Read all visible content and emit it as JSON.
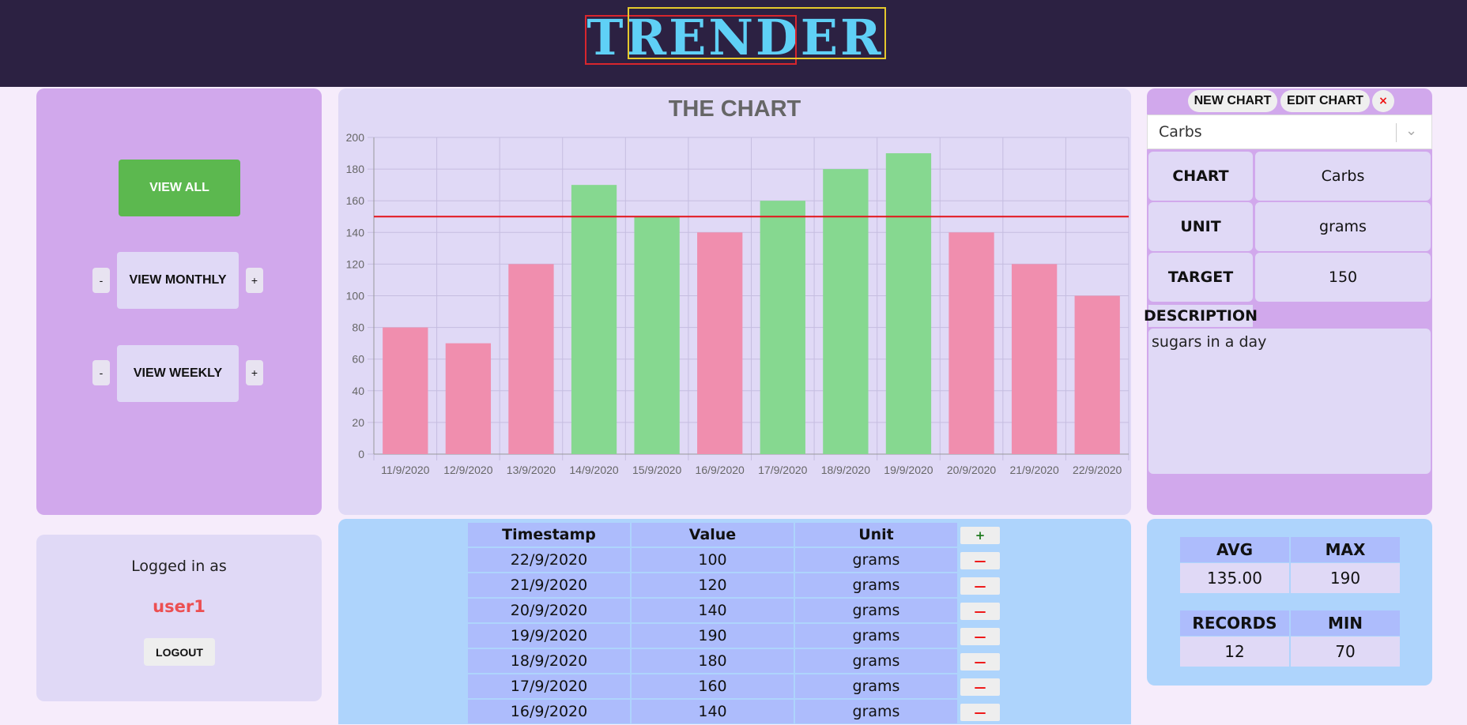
{
  "header": {
    "logo": "TRENDER"
  },
  "left_panel": {
    "view_all": "VIEW ALL",
    "view_monthly": "VIEW MONTHLY",
    "view_weekly": "VIEW WEEKLY",
    "minus": "-",
    "plus": "+"
  },
  "user": {
    "logged_in_as": "Logged in as",
    "username": "user1",
    "logout": "LOGOUT"
  },
  "chart_data": {
    "type": "bar",
    "title": "THE CHART",
    "categories": [
      "11/9/2020",
      "12/9/2020",
      "13/9/2020",
      "14/9/2020",
      "15/9/2020",
      "16/9/2020",
      "17/9/2020",
      "18/9/2020",
      "19/9/2020",
      "20/9/2020",
      "21/9/2020",
      "22/9/2020"
    ],
    "values": [
      80,
      70,
      120,
      170,
      150,
      140,
      160,
      180,
      190,
      140,
      120,
      100
    ],
    "target": 150,
    "ylim": [
      0,
      200
    ],
    "yticks": [
      0,
      20,
      40,
      60,
      80,
      100,
      120,
      140,
      160,
      180,
      200
    ],
    "colors": {
      "above": "#86d890",
      "below": "#f08eae",
      "target_line": "#e3121b"
    },
    "grid": true
  },
  "table": {
    "headers": {
      "timestamp": "Timestamp",
      "value": "Value",
      "unit": "Unit"
    },
    "add": "+",
    "remove": "—",
    "rows": [
      {
        "timestamp": "22/9/2020",
        "value": "100",
        "unit": "grams"
      },
      {
        "timestamp": "21/9/2020",
        "value": "120",
        "unit": "grams"
      },
      {
        "timestamp": "20/9/2020",
        "value": "140",
        "unit": "grams"
      },
      {
        "timestamp": "19/9/2020",
        "value": "190",
        "unit": "grams"
      },
      {
        "timestamp": "18/9/2020",
        "value": "180",
        "unit": "grams"
      },
      {
        "timestamp": "17/9/2020",
        "value": "160",
        "unit": "grams"
      },
      {
        "timestamp": "16/9/2020",
        "value": "140",
        "unit": "grams"
      }
    ]
  },
  "right_panel": {
    "new_chart": "NEW CHART",
    "edit_chart": "EDIT CHART",
    "close": "×",
    "selected_chart": "Carbs",
    "chart_label": "CHART",
    "chart_value": "Carbs",
    "unit_label": "UNIT",
    "unit_value": "grams",
    "target_label": "TARGET",
    "target_value": "150",
    "description_label": "DESCRIPTION",
    "description": "sugars in a day"
  },
  "stats": {
    "avg_label": "AVG",
    "avg": "135.00",
    "max_label": "MAX",
    "max": "190",
    "records_label": "RECORDS",
    "records": "12",
    "min_label": "MIN",
    "min": "70"
  }
}
